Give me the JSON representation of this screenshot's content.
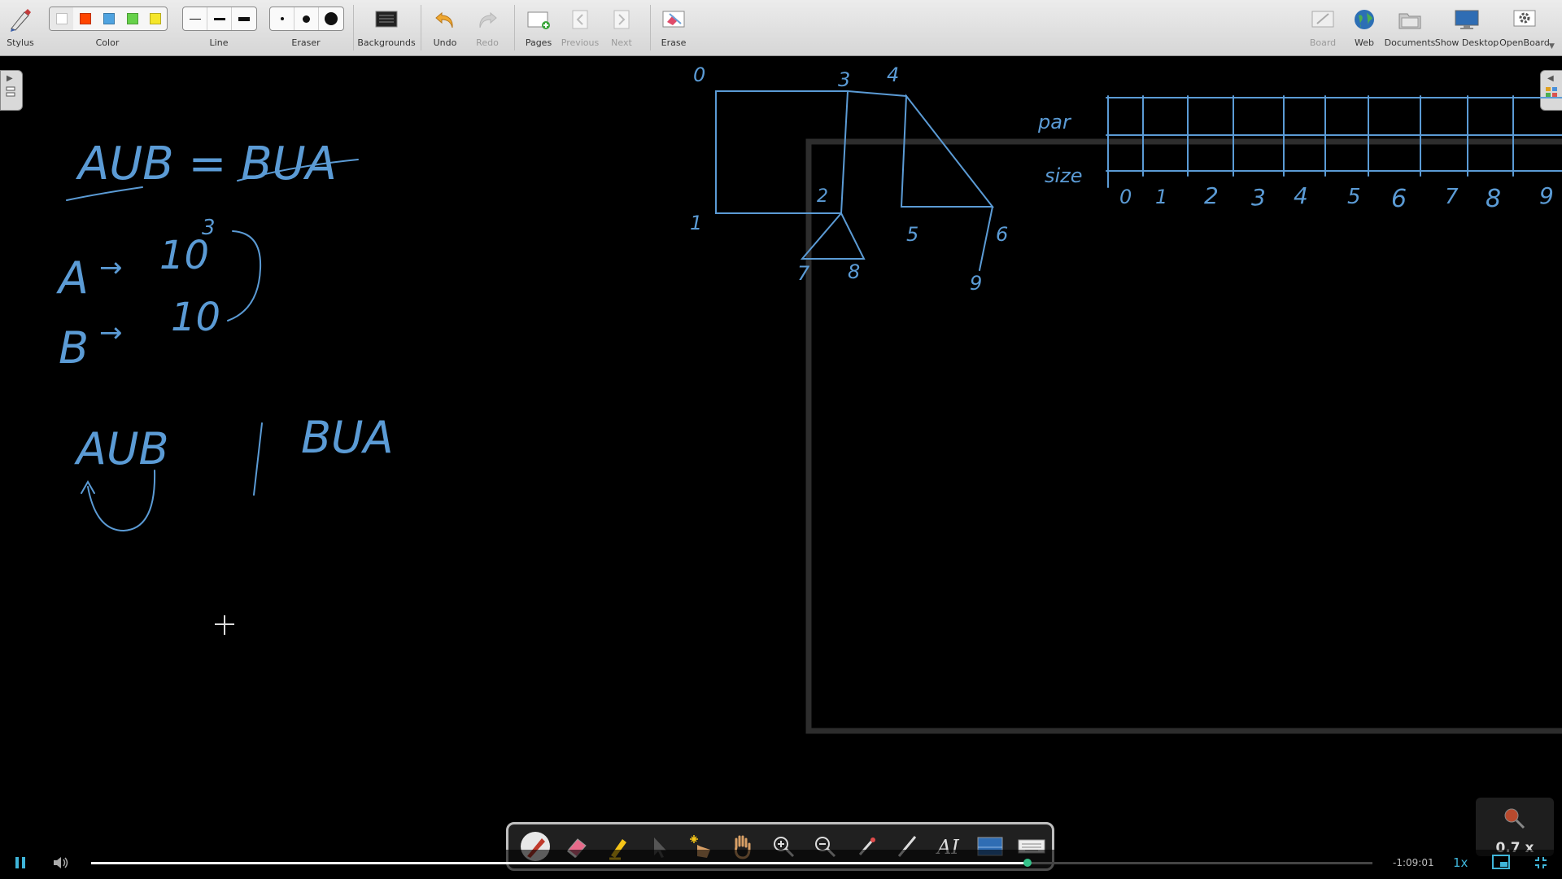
{
  "toolbar": {
    "stylus": "Stylus",
    "color": "Color",
    "line": "Line",
    "eraser": "Eraser",
    "backgrounds": "Backgrounds",
    "undo": "Undo",
    "redo": "Redo",
    "pages": "Pages",
    "previous": "Previous",
    "next": "Next",
    "erase": "Erase",
    "board": "Board",
    "web": "Web",
    "documents": "Documents",
    "show_desktop": "Show Desktop",
    "openboard": "OpenBoard"
  },
  "colors": [
    "#ffffff",
    "#ff4500",
    "#4fa3e0",
    "#66d14a",
    "#f5e62a"
  ],
  "accent_ink": "#5b9bd5",
  "board": {
    "eq1": "AUB = BUA",
    "a_label": "A",
    "a_val": "10",
    "a_exp": "3",
    "b_label": "B",
    "b_val": "10",
    "union_left": "AUB",
    "union_right": "BUA",
    "nodes": [
      "0",
      "3",
      "4",
      "1",
      "2",
      "5",
      "6",
      "7",
      "8",
      "9"
    ],
    "par_label": "par",
    "size_label": "size",
    "indices": [
      "0",
      "1",
      "2",
      "3",
      "4",
      "5",
      "6",
      "7",
      "8",
      "9"
    ]
  },
  "player": {
    "time_remaining": "-1:09:01",
    "speed": "1x",
    "zoom": "0.7 x",
    "progress": 0.731
  }
}
